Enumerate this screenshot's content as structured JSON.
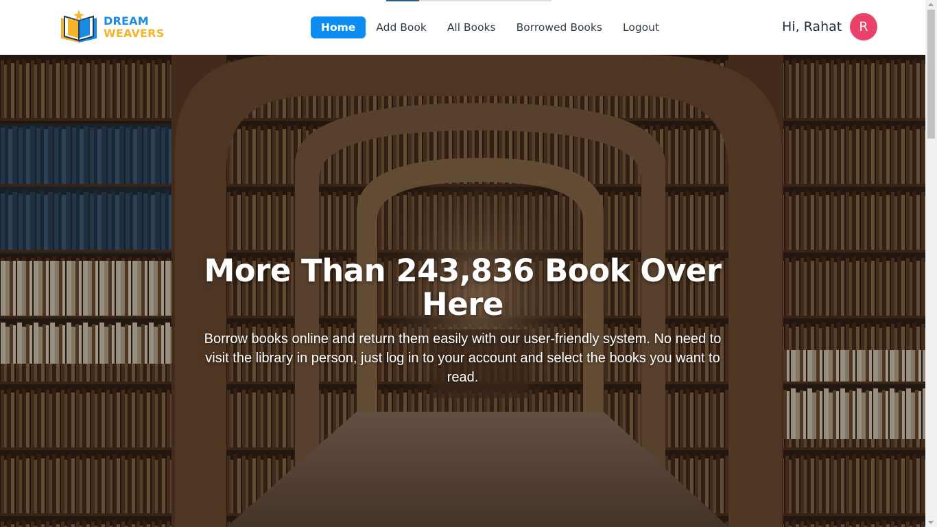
{
  "brand": {
    "name_line1": "DREAM",
    "name_line2": "WEAVERS",
    "primary_color": "#1a8be0",
    "accent_color": "#f6b42c",
    "logo_icon": "open-book-star-icon"
  },
  "nav": {
    "items": [
      {
        "label": "Home",
        "active": true
      },
      {
        "label": "Add Book",
        "active": false
      },
      {
        "label": "All Books",
        "active": false
      },
      {
        "label": "Borrowed Books",
        "active": false
      },
      {
        "label": "Logout",
        "active": false
      }
    ],
    "active_color": "#0d8cf2"
  },
  "user": {
    "greeting": "Hi, Rahat",
    "avatar_initial": "R",
    "avatar_color": "#e8416a"
  },
  "hero": {
    "title": "More Than 243,836 Book Over Here",
    "description": "Borrow books online and return them easily with our user-friendly system. No need to visit the library in person, just log in to your account and select the books you want to read.",
    "background": "library-bookshelves-arches-image"
  }
}
